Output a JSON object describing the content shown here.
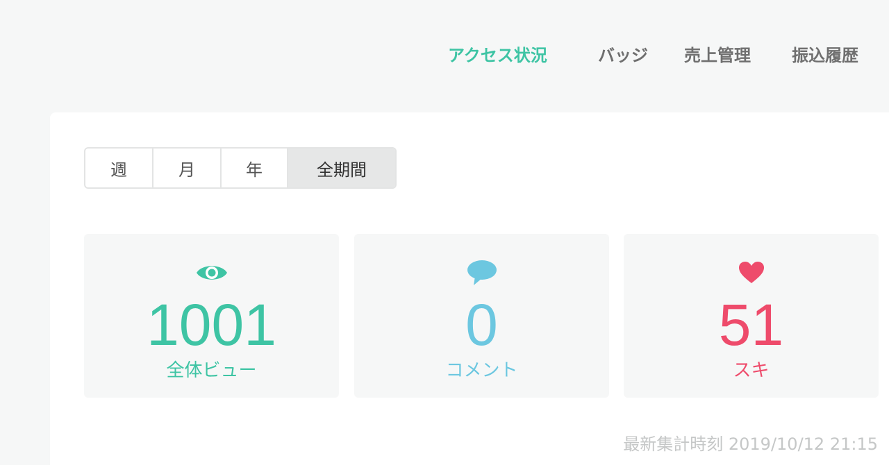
{
  "nav": {
    "items": [
      {
        "label": "アクセス状況"
      },
      {
        "label": "バッジ"
      },
      {
        "label": "売上管理"
      },
      {
        "label": "振込履歴"
      }
    ],
    "active_color": "#3ec4a4",
    "inactive_color": "#6f6f6f"
  },
  "period": {
    "options": [
      {
        "label": "週"
      },
      {
        "label": "月"
      },
      {
        "label": "年"
      },
      {
        "label": "全期間"
      }
    ],
    "selected": "全期間"
  },
  "stats": [
    {
      "icon": "eye-icon",
      "value": "1001",
      "label": "全体ビュー",
      "color": "#3ec4a4"
    },
    {
      "icon": "speech-bubble-icon",
      "value": "0",
      "label": "コメント",
      "color": "#6cc7e0"
    },
    {
      "icon": "heart-icon",
      "value": "51",
      "label": "スキ",
      "color": "#ee4b6b"
    }
  ],
  "updated": {
    "text": "最新集計時刻 2019/10/12 21:15"
  }
}
